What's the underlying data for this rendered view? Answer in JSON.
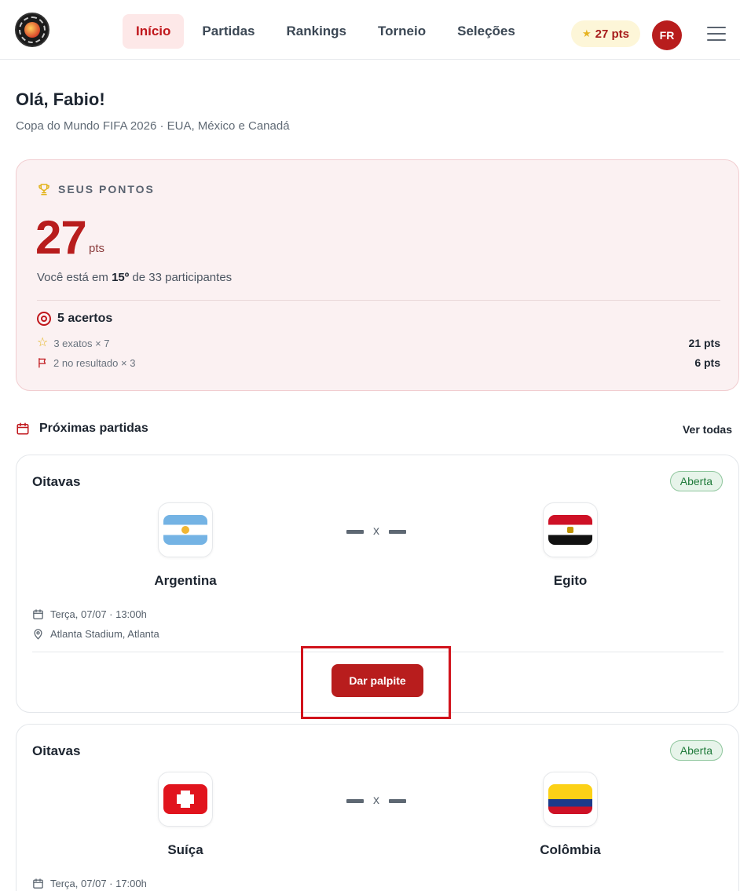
{
  "header": {
    "logo_alt": "Força Sindical",
    "nav": [
      {
        "label": "Início",
        "active": true
      },
      {
        "label": "Partidas",
        "active": false
      },
      {
        "label": "Rankings",
        "active": false
      },
      {
        "label": "Torneio",
        "active": false
      },
      {
        "label": "Seleções",
        "active": false
      }
    ],
    "points_chip": "27 pts",
    "avatar_initials": "FR"
  },
  "greeting": {
    "title": "Olá, Fabio!",
    "subtitle": "Copa do Mundo FIFA 2026 · EUA, México e Canadá"
  },
  "points_card": {
    "label": "SEUS PONTOS",
    "value": "27",
    "unit": "pts",
    "rank_prefix": "Você está em ",
    "rank": "15º",
    "rank_suffix": " de 33 participantes",
    "hits_label": "5 acertos",
    "details": [
      {
        "label": "3 exatos × 7",
        "value": "21 pts",
        "icon": "star-icon"
      },
      {
        "label": "2 no resultado × 3",
        "value": "6 pts",
        "icon": "flag-icon"
      }
    ]
  },
  "upcoming": {
    "title": "Próximas partidas",
    "see_all": "Ver todas",
    "matches": [
      {
        "stage": "Oitavas",
        "status": "Aberta",
        "home": "Argentina",
        "away": "Egito",
        "score_sep": "x",
        "date": "Terça, 07/07 · 13:00h",
        "venue": "Atlanta Stadium, Atlanta",
        "cta": "Dar palpite"
      },
      {
        "stage": "Oitavas",
        "status": "Aberta",
        "home": "Suíça",
        "away": "Colômbia",
        "score_sep": "x",
        "date": "Terça, 07/07 · 17:00h"
      }
    ]
  },
  "colors": {
    "accent": "#b81d1d",
    "open_status": "#1f7a3a",
    "highlight_box": "#d1131c"
  }
}
